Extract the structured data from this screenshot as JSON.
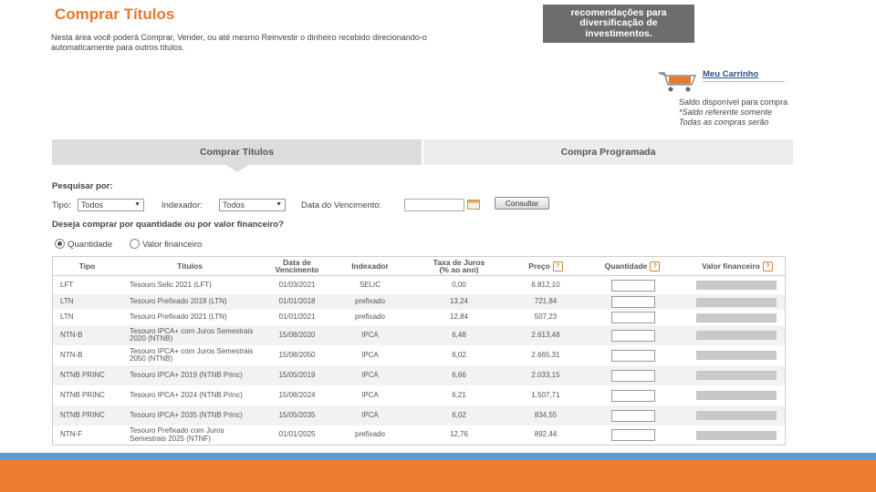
{
  "header": {
    "title": "Comprar Títulos",
    "intro": "Nesta área você poderá Comprar, Vender, ou até mesmo Reinvestir o dinheiro recebido direcionando-o automaticamente para outros títulos."
  },
  "banner": {
    "line1": "recomendações para",
    "line2": "diversificação de",
    "line3": "investimentos."
  },
  "cart": {
    "icon": "shopping-cart-icon",
    "link": "Meu Carrinho",
    "saldo_line1": "Saldo disponível para compra",
    "saldo_line2": "*Saldo referente somente",
    "saldo_line3": "Todas as compras serão"
  },
  "tabs": [
    {
      "label": "Comprar Títulos",
      "active": true
    },
    {
      "label": "Compra Programada",
      "active": false
    }
  ],
  "search": {
    "label": "Pesquisar por:",
    "tipo_label": "Tipo:",
    "tipo_value": "Todos",
    "indexador_label": "Indexador:",
    "indexador_value": "Todos",
    "data_label": "Data do Vencimento:",
    "button": "Consultar"
  },
  "purchase_mode": {
    "question": "Deseja comprar por quantidade ou por valor financeiro?",
    "options": [
      {
        "label": "Quantidade",
        "selected": true
      },
      {
        "label": "Valor financeiro",
        "selected": false
      }
    ]
  },
  "table": {
    "headers": {
      "tipo": "Tipo",
      "titulos": "Títulos",
      "vencimento_1": "Data de",
      "vencimento_2": "Vencimento",
      "indexador": "Indexador",
      "taxa_1": "Taxa de Juros",
      "taxa_2": "(% ao ano)",
      "preco": "Preço",
      "quantidade": "Quantidade",
      "valor": "Valor financeiro"
    },
    "help_symbol": "?",
    "rows": [
      {
        "tipo": "LFT",
        "titulo": "Tesouro Selic 2021 (LFT)",
        "vencimento": "01/03/2021",
        "indexador": "SELIC",
        "taxa": "0,00",
        "preco": "6.812,10"
      },
      {
        "tipo": "LTN",
        "titulo": "Tesouro Prefixado 2018 (LTN)",
        "vencimento": "01/01/2018",
        "indexador": "prefixado",
        "taxa": "13,24",
        "preco": "721,84"
      },
      {
        "tipo": "LTN",
        "titulo": "Tesouro Prefixado 2021 (LTN)",
        "vencimento": "01/01/2021",
        "indexador": "prefixado",
        "taxa": "12,84",
        "preco": "507,23"
      },
      {
        "tipo": "NTN-B",
        "titulo": "Tesouro IPCA+ com Juros Semestrais 2020 (NTNB)",
        "vencimento": "15/08/2020",
        "indexador": "IPCA",
        "taxa": "6,48",
        "preco": "2.613,48"
      },
      {
        "tipo": "NTN-B",
        "titulo": "Tesouro IPCA+ com Juros Semestrais 2050 (NTNB)",
        "vencimento": "15/08/2050",
        "indexador": "IPCA",
        "taxa": "6,02",
        "preco": "2.665,31"
      },
      {
        "tipo": "NTNB PRINC",
        "titulo": "Tesouro IPCA+ 2019 (NTNB Princ)",
        "vencimento": "15/05/2019",
        "indexador": "IPCA",
        "taxa": "6,66",
        "preco": "2.033,15"
      },
      {
        "tipo": "NTNB PRINC",
        "titulo": "Tesouro IPCA+ 2024 (NTNB Princ)",
        "vencimento": "15/08/2024",
        "indexador": "IPCA",
        "taxa": "6,21",
        "preco": "1.507,71"
      },
      {
        "tipo": "NTNB PRINC",
        "titulo": "Tesouro IPCA+ 2035 (NTNB Princ)",
        "vencimento": "15/05/2035",
        "indexador": "IPCA",
        "taxa": "6,02",
        "preco": "834,55"
      },
      {
        "tipo": "NTN-F",
        "titulo": "Tesouro Prefixado com Juros Semestrais 2025 (NTNF)",
        "vencimento": "01/01/2025",
        "indexador": "prefixado",
        "taxa": "12,76",
        "preco": "892,44"
      }
    ]
  },
  "colors": {
    "accent": "#e8782a",
    "footer_blue": "#5b9bd5",
    "footer_orange": "#ed7d31"
  }
}
